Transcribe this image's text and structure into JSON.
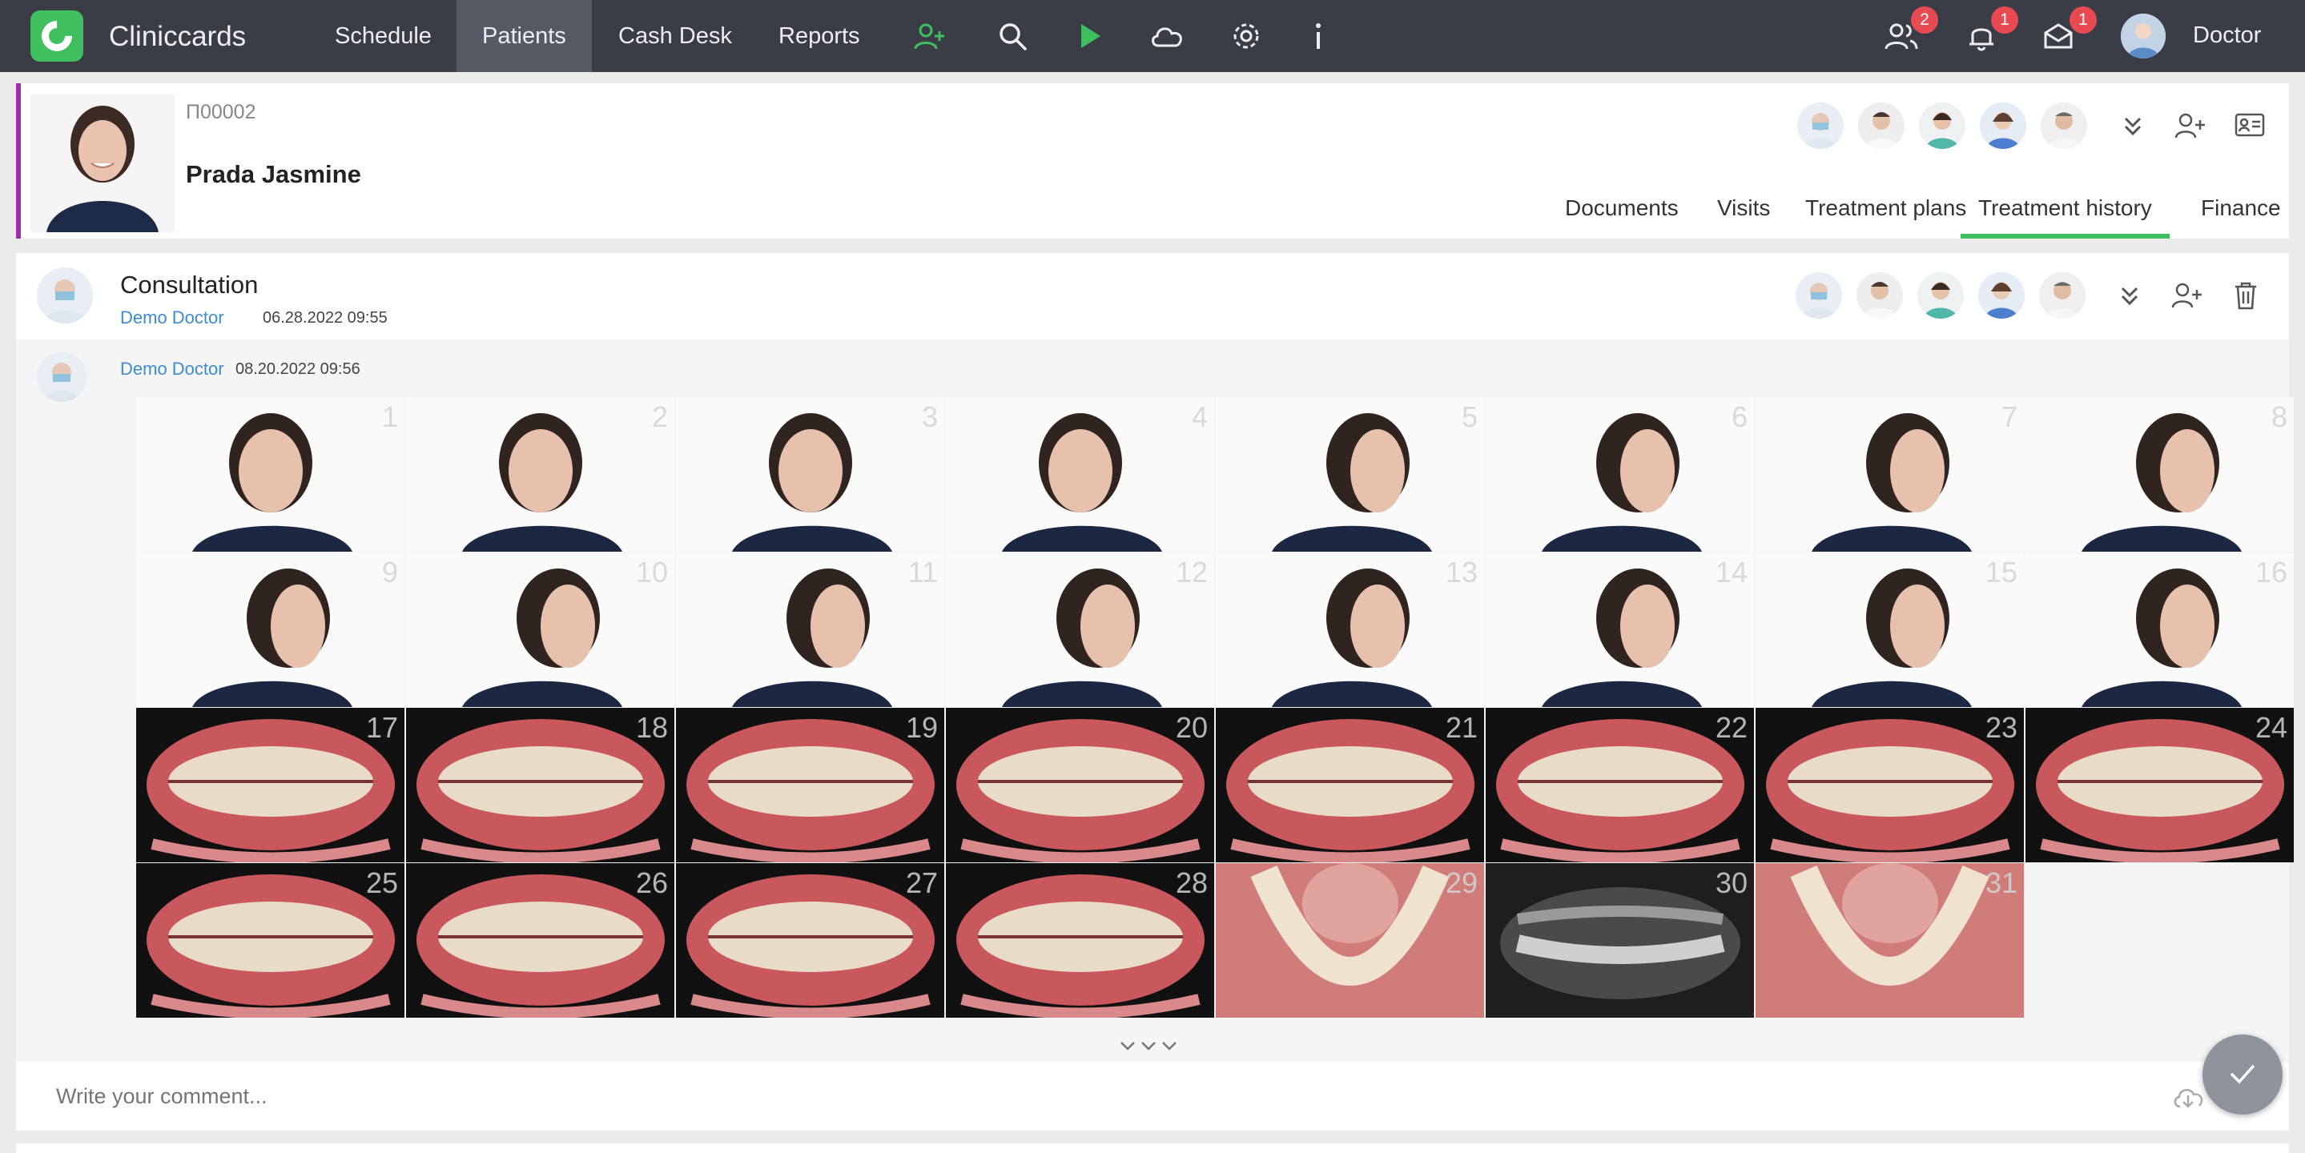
{
  "app": {
    "brand": "Cliniccards"
  },
  "nav": {
    "items": [
      {
        "label": "Schedule"
      },
      {
        "label": "Patients",
        "active": true
      },
      {
        "label": "Cash Desk"
      },
      {
        "label": "Reports"
      }
    ],
    "icons": [
      "add-patient-icon",
      "search-icon",
      "play-icon",
      "cloud-icon",
      "gear-icon",
      "info-icon"
    ],
    "badges": {
      "patients": "2",
      "notifications": "1",
      "messages": "1"
    },
    "user_name": "Doctor"
  },
  "patient": {
    "id": "П00002",
    "name": "Prada Jasmine",
    "accent_color": "#9b2fae",
    "tabs": [
      {
        "label": "Documents"
      },
      {
        "label": "Visits"
      },
      {
        "label": "Treatment plans"
      },
      {
        "label": "Treatment history",
        "active": true
      },
      {
        "label": "Finance"
      }
    ]
  },
  "consultation": {
    "title": "Consultation",
    "doctor": "Demo Doctor",
    "date": "06.28.2022 09:55",
    "entry": {
      "doctor": "Demo Doctor",
      "date": "08.20.2022 09:56"
    },
    "images": [
      {
        "n": "1",
        "kind": "face"
      },
      {
        "n": "2",
        "kind": "face"
      },
      {
        "n": "3",
        "kind": "face"
      },
      {
        "n": "4",
        "kind": "face"
      },
      {
        "n": "5",
        "kind": "face"
      },
      {
        "n": "6",
        "kind": "face"
      },
      {
        "n": "7",
        "kind": "face"
      },
      {
        "n": "8",
        "kind": "face"
      },
      {
        "n": "9",
        "kind": "face"
      },
      {
        "n": "10",
        "kind": "face"
      },
      {
        "n": "11",
        "kind": "face"
      },
      {
        "n": "12",
        "kind": "face"
      },
      {
        "n": "13",
        "kind": "face"
      },
      {
        "n": "14",
        "kind": "face"
      },
      {
        "n": "15",
        "kind": "face"
      },
      {
        "n": "16",
        "kind": "face"
      },
      {
        "n": "17",
        "kind": "teeth"
      },
      {
        "n": "18",
        "kind": "teeth"
      },
      {
        "n": "19",
        "kind": "teeth"
      },
      {
        "n": "20",
        "kind": "teeth"
      },
      {
        "n": "21",
        "kind": "teeth"
      },
      {
        "n": "22",
        "kind": "teeth"
      },
      {
        "n": "23",
        "kind": "teeth"
      },
      {
        "n": "24",
        "kind": "teeth"
      },
      {
        "n": "25",
        "kind": "teeth"
      },
      {
        "n": "26",
        "kind": "teeth"
      },
      {
        "n": "27",
        "kind": "teeth"
      },
      {
        "n": "28",
        "kind": "teeth"
      },
      {
        "n": "29",
        "kind": "occ"
      },
      {
        "n": "30",
        "kind": "xray"
      },
      {
        "n": "31",
        "kind": "occ"
      }
    ],
    "comment_placeholder": "Write your comment..."
  },
  "colors": {
    "topbar": "#3a3d46",
    "brand_green": "#3fbf5e",
    "badge_red": "#e84a52",
    "link_blue": "#3d8bd1"
  }
}
